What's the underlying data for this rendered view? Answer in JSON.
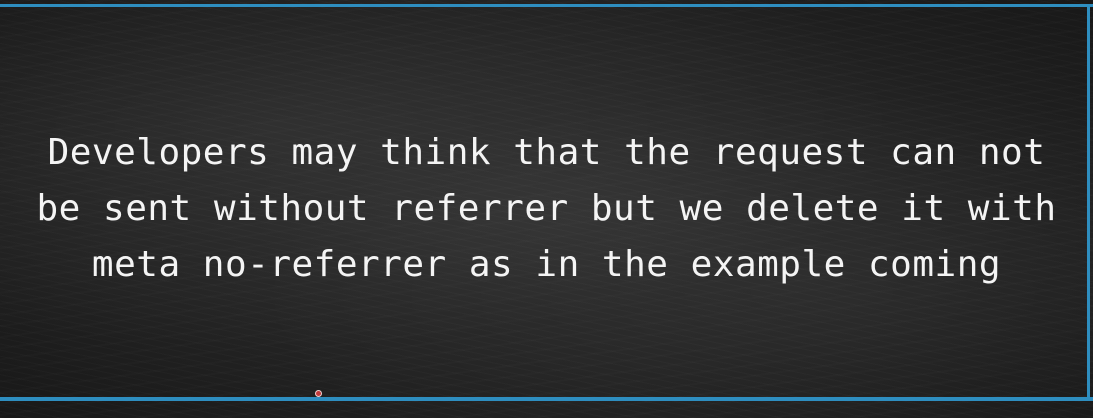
{
  "slide": {
    "lines": [
      "Developers may think that the request can not",
      "be sent without referrer but we delete it with",
      "meta no-referrer as in the example coming"
    ]
  },
  "colors": {
    "frame": "#2e8ec0",
    "background": "#262626",
    "text": "#f4f4f4",
    "cursor": "#c23a3a"
  }
}
